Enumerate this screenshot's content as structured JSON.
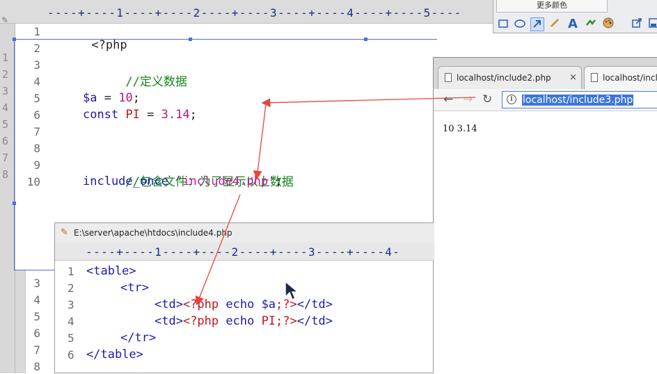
{
  "background_editor": {
    "ruler": "----+----1----+----2----+----3----+----4----+----5----",
    "ruler_end_digit": "7",
    "side_strip_numbers": [
      "1",
      "2",
      "3",
      "4",
      "5",
      "6",
      "7",
      "8"
    ],
    "lower_strip_numbers": [
      "3",
      "4",
      "5",
      "6",
      "7",
      "8"
    ],
    "line_numbers": [
      "1",
      "2",
      "3",
      "4",
      "5",
      "6",
      "7",
      "8",
      "9",
      "10"
    ],
    "code": {
      "line1": "<?php",
      "line3": "//定义数据",
      "line5_var": "$a",
      "line5_op": " = ",
      "line5_num": "10",
      "line5_end": ";",
      "line6_kw": "const",
      "line6_const": "PI",
      "line6_op": " = ",
      "line6_num": "3.14",
      "line6_end": ";",
      "line9": "//包含文件：为了显示以上数据",
      "line10_kw": "include_once",
      "line10_str": "'include4.php'",
      "line10_end": ";"
    }
  },
  "toolbar": {
    "more_colors": "更多颜色",
    "tools": [
      "rectangle-icon",
      "ellipse-icon",
      "arrow-icon",
      "brush-icon",
      "text-icon",
      "undo-icon",
      "palette-icon",
      "export-icon",
      "save-icon"
    ],
    "text_tool_label": "A"
  },
  "browser": {
    "tabs": [
      {
        "label": "localhost/include2.php",
        "close": "×"
      },
      {
        "label": "localhost/incl"
      }
    ],
    "url": "localhost/include3.php",
    "info_glyph": "i",
    "output": "10 3.14"
  },
  "include_window": {
    "title": "E:\\server\\apache\\htdocs\\include4.php",
    "ruler": "----+----1----+----2----+----3----+----4-",
    "line_numbers": [
      "1",
      "2",
      "3",
      "4",
      "5",
      "6"
    ],
    "lines": {
      "l1": "<table>",
      "l2": "<tr>",
      "l3_open": "<td>",
      "l3_php": "<?php",
      "l3_mid": " echo ",
      "l3_var": "$a",
      "l3_phpclose": ";?>",
      "l3_close": "</td>",
      "l4_open": "<td>",
      "l4_php": "<?php",
      "l4_mid": " echo ",
      "l4_const": "PI",
      "l4_phpclose": ";?>",
      "l4_close": "</td>",
      "l5": "</tr>",
      "l6": "</table>"
    }
  },
  "colors": {
    "annotation_arrow": "#e8463a",
    "selection": "#4e6fd8",
    "comment": "#15861f",
    "keyword": "#1c1ca8"
  }
}
